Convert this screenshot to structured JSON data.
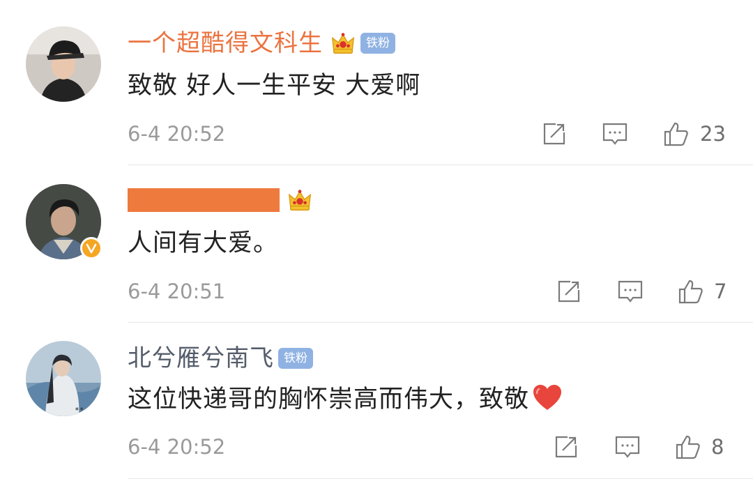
{
  "comments": [
    {
      "username": "一个超酷得文科生",
      "badge": "铁粉",
      "text": "致敬 好人一生平安 大爱啊",
      "time": "6-4 20:52",
      "likes": "23"
    },
    {
      "username": "",
      "text": "人间有大爱。",
      "time": "6-4 20:51",
      "likes": "7"
    },
    {
      "username": "北兮雁兮南飞",
      "badge": "铁粉",
      "text": "这位快递哥的胸怀崇高而伟大，致敬",
      "time": "6-4 20:52",
      "likes": "8"
    }
  ],
  "colors": {
    "vip_name": "#eb7340",
    "normal_name": "#555d6b",
    "fan_badge": "#8fb2e3",
    "verified": "#f5a623",
    "heart": "#e8453c"
  },
  "icons": [
    "crown-icon",
    "repost-icon",
    "comment-icon",
    "like-icon",
    "heart-icon",
    "verified-icon"
  ]
}
